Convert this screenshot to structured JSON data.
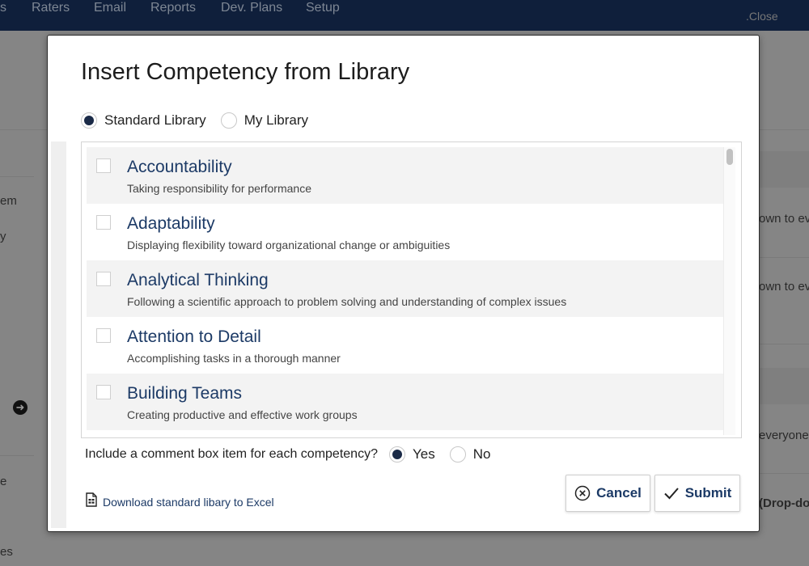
{
  "nav": {
    "items": [
      "s",
      "Raters",
      "Email",
      "Reports",
      "Dev. Plans",
      "Setup"
    ],
    "close_label": ".Close"
  },
  "background": {
    "left_fragments": [
      "em",
      "y",
      "e",
      "es"
    ],
    "right_fragments": [
      "own to ev",
      "own to ev",
      "everyone",
      "(Drop-do"
    ]
  },
  "modal": {
    "title": "Insert Competency from Library",
    "library_options": [
      {
        "label": "Standard Library",
        "selected": true
      },
      {
        "label": "My Library",
        "selected": false
      }
    ],
    "competencies": [
      {
        "title": "Accountability",
        "description": "Taking responsibility for performance",
        "checked": false
      },
      {
        "title": "Adaptability",
        "description": "Displaying flexibility toward organizational change or ambiguities",
        "checked": false
      },
      {
        "title": "Analytical Thinking",
        "description": "Following a scientific approach to problem solving and understanding of complex issues",
        "checked": false
      },
      {
        "title": "Attention to Detail",
        "description": "Accomplishing tasks in a thorough manner",
        "checked": false
      },
      {
        "title": "Building Teams",
        "description": "Creating productive and effective work groups",
        "checked": false
      }
    ],
    "comment_question": "Include a comment box item for each competency?",
    "comment_options": [
      {
        "label": "Yes",
        "selected": true
      },
      {
        "label": "No",
        "selected": false
      }
    ],
    "download_label": "Download standard libary to Excel",
    "cancel_label": "Cancel",
    "submit_label": "Submit"
  },
  "colors": {
    "navbar": "#0f1f3b",
    "accent": "#1c3a66",
    "radio_selected": "#1a2a47"
  }
}
